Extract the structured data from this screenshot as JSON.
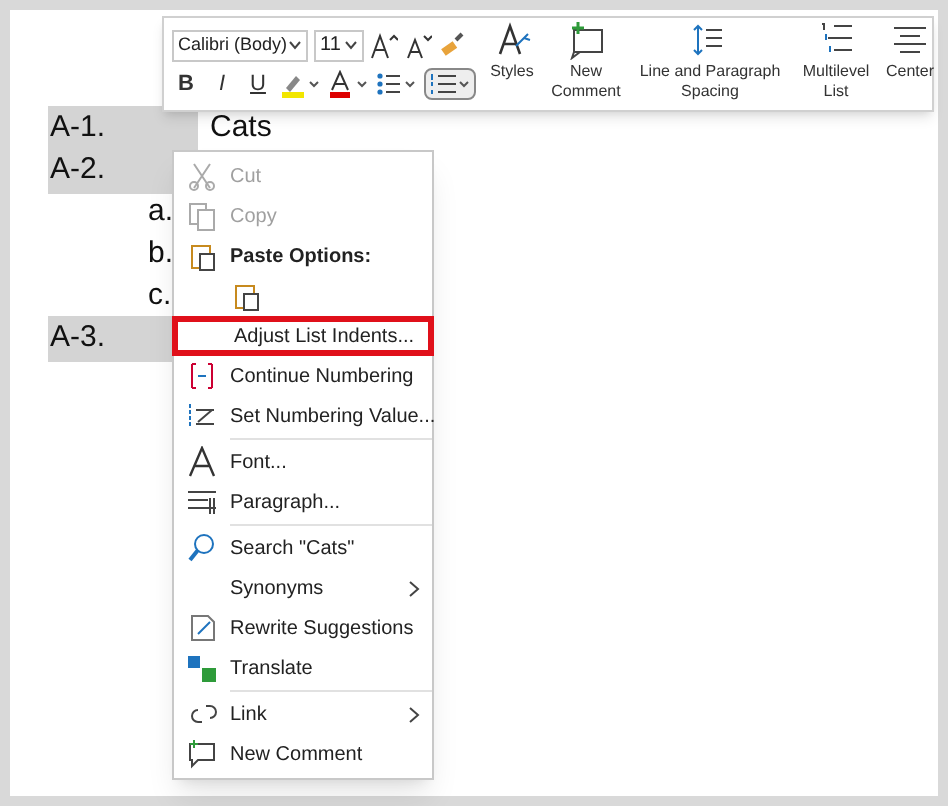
{
  "mini_toolbar": {
    "font": "Calibri (Body)",
    "size": "11",
    "format_buttons": [
      {
        "label": "B",
        "kind": "bold"
      },
      {
        "label": "I",
        "kind": "italic"
      },
      {
        "label": "U",
        "kind": "underline"
      }
    ],
    "numbering_selected": true,
    "big_buttons": [
      {
        "label": "Styles"
      },
      {
        "label": "New Comment"
      },
      {
        "label": "Line and Paragraph Spacing"
      },
      {
        "label": "Multilevel List"
      },
      {
        "label": "Center"
      }
    ]
  },
  "document": {
    "lines": [
      {
        "number": "A-1.",
        "text": "Cats",
        "kind": "top",
        "highlighted": true
      },
      {
        "number": "A-2.",
        "kind": "top",
        "highlighted": true
      },
      {
        "number": "a.",
        "kind": "sub",
        "highlighted": false
      },
      {
        "number": "b.",
        "kind": "sub",
        "highlighted": false
      },
      {
        "number": "c.",
        "kind": "sub",
        "highlighted": false
      },
      {
        "number": "A-3.",
        "kind": "top",
        "highlighted": true
      }
    ]
  },
  "context_menu": {
    "items": [
      {
        "kind": "item",
        "label": "Cut",
        "disabled": true
      },
      {
        "kind": "item",
        "label": "Copy",
        "disabled": true
      },
      {
        "kind": "header",
        "label": "Paste Options:"
      },
      {
        "kind": "paste"
      },
      {
        "kind": "item",
        "label": "Adjust List Indents...",
        "disabled": false,
        "outlined": true
      },
      {
        "kind": "item",
        "label": "Continue Numbering",
        "disabled": false
      },
      {
        "kind": "item",
        "label": "Set Numbering Value...",
        "disabled": false
      },
      {
        "kind": "separator"
      },
      {
        "kind": "item",
        "label": "Font...",
        "disabled": false
      },
      {
        "kind": "item",
        "label": "Paragraph...",
        "disabled": false
      },
      {
        "kind": "separator"
      },
      {
        "kind": "item",
        "label": "Search \"Cats\"",
        "disabled": false
      },
      {
        "kind": "item",
        "label": "Synonyms",
        "disabled": false,
        "submenu": true
      },
      {
        "kind": "item",
        "label": "Rewrite Suggestions",
        "disabled": false
      },
      {
        "kind": "item",
        "label": "Translate",
        "disabled": false
      },
      {
        "kind": "separator"
      },
      {
        "kind": "item",
        "label": "Link",
        "disabled": false,
        "submenu": true
      },
      {
        "kind": "item",
        "label": "New Comment",
        "disabled": false
      }
    ]
  }
}
